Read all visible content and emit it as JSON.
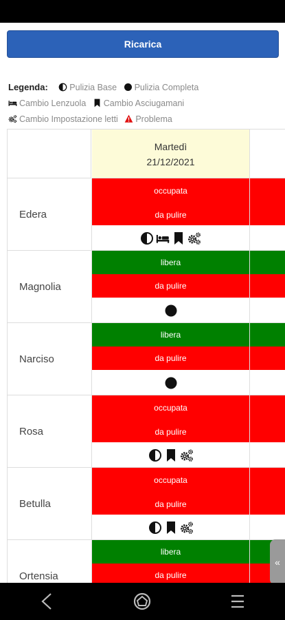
{
  "reload_label": "Ricarica",
  "legend": {
    "title": "Legenda:",
    "items": [
      {
        "icon": "half-circle-icon",
        "label": "Pulizia Base"
      },
      {
        "icon": "full-circle-icon",
        "label": "Pulizia Completa"
      },
      {
        "icon": "bed-icon",
        "label": "Cambio Lenzuola"
      },
      {
        "icon": "bookmark-icon",
        "label": "Cambio Asciugamani"
      },
      {
        "icon": "gears-icon",
        "label": "Cambio Impostazione letti"
      },
      {
        "icon": "warning-icon",
        "label": "Problema"
      }
    ]
  },
  "date_header": {
    "day": "Martedì",
    "date": "21/12/2021"
  },
  "rooms": [
    {
      "name": "Edera",
      "occupancy": "occupata",
      "cleaning": "da pulire",
      "icons": [
        "half-circle-icon",
        "bed-icon",
        "bookmark-icon",
        "gears-icon"
      ]
    },
    {
      "name": "Magnolia",
      "occupancy": "libera",
      "cleaning": "da pulire",
      "icons": [
        "full-circle-icon"
      ]
    },
    {
      "name": "Narciso",
      "occupancy": "libera",
      "cleaning": "da pulire",
      "icons": [
        "full-circle-icon"
      ]
    },
    {
      "name": "Rosa",
      "occupancy": "occupata",
      "cleaning": "da pulire",
      "icons": [
        "half-circle-icon",
        "bookmark-icon",
        "gears-icon"
      ]
    },
    {
      "name": "Betulla",
      "occupancy": "occupata",
      "cleaning": "da pulire",
      "icons": [
        "half-circle-icon",
        "bookmark-icon",
        "gears-icon"
      ]
    },
    {
      "name": "Ortensia",
      "occupancy": "libera",
      "cleaning": "da pulire",
      "icons": []
    }
  ],
  "side_tab_label": "«",
  "colors": {
    "occupied": "#ff0000",
    "free": "#008000",
    "to_clean": "#ff0000",
    "button": "#2c62b8",
    "date_header_bg": "#fdfbd8"
  },
  "nav": {
    "icons": [
      "back-icon",
      "home-icon",
      "recents-icon"
    ]
  }
}
